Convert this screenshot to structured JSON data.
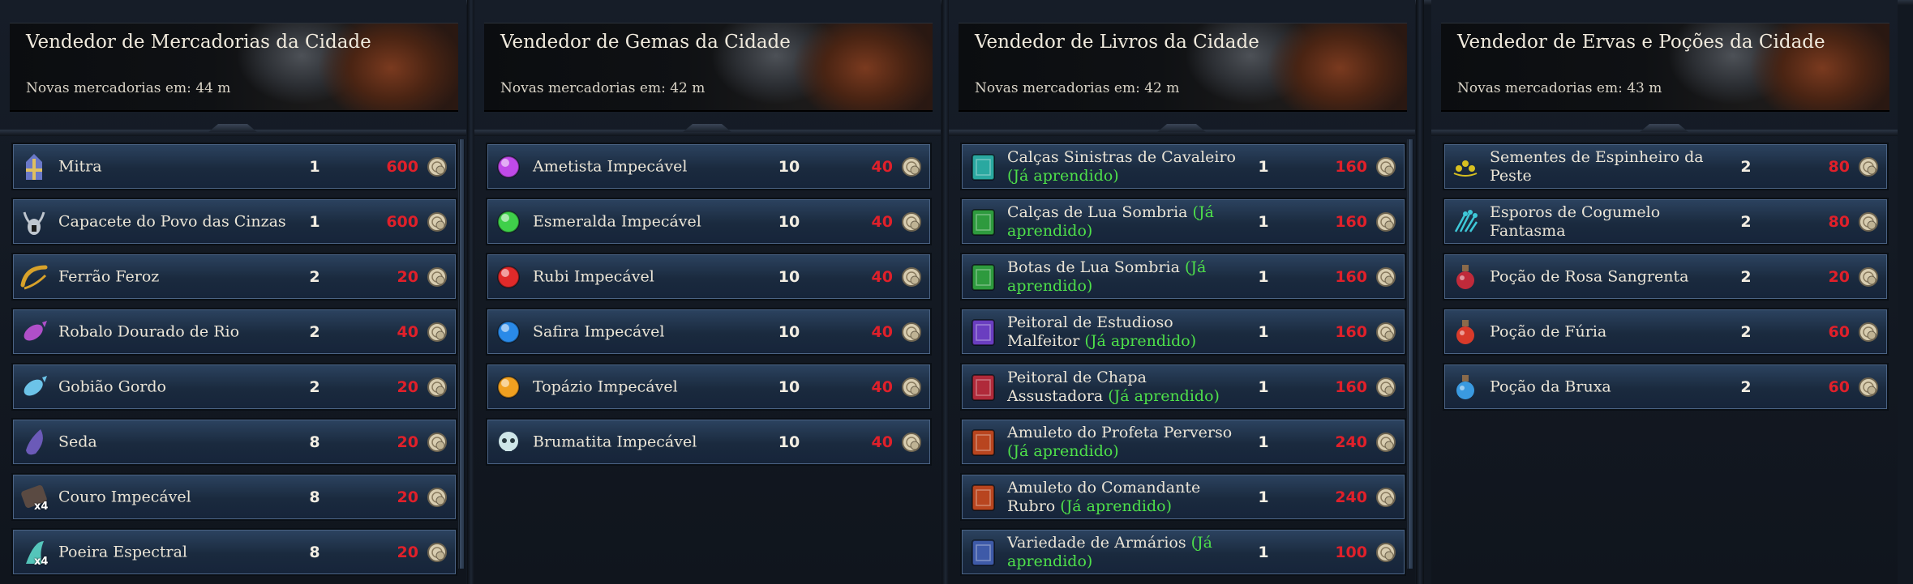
{
  "colors": {
    "price_red": "#e0202a",
    "learned_green": "#4ee04a",
    "row_blue": "#2c4360",
    "background": "#121821"
  },
  "vendors": [
    {
      "title": "Vendedor de Mercadorias da Cidade",
      "subtitle": "Novas mercadorias em: 44 m",
      "scrollbar": true,
      "items": [
        {
          "name": "Mitra",
          "learned": "",
          "qty": "1",
          "price": "600",
          "icon": "miter-icon",
          "icon_color": "#6a78c8"
        },
        {
          "name": "Capacete do Povo das Cinzas",
          "learned": "",
          "qty": "1",
          "price": "600",
          "icon": "horned-helmet-icon",
          "icon_color": "#bfc6cf"
        },
        {
          "name": "Ferrão Feroz",
          "learned": "",
          "qty": "2",
          "price": "20",
          "icon": "stinger-icon",
          "icon_color": "#d8a22a"
        },
        {
          "name": "Robalo Dourado de Rio",
          "learned": "",
          "qty": "2",
          "price": "40",
          "icon": "fish-icon",
          "icon_color": "#b04fc9"
        },
        {
          "name": "Gobião Gordo",
          "learned": "",
          "qty": "2",
          "price": "20",
          "icon": "fish-icon",
          "icon_color": "#6cc3e8"
        },
        {
          "name": "Seda",
          "learned": "",
          "qty": "8",
          "price": "20",
          "icon": "silk-icon",
          "icon_color": "#6b5ab8"
        },
        {
          "name": "Couro Impecável",
          "learned": "",
          "qty": "8",
          "price": "20",
          "icon": "leather-icon",
          "icon_color": "#5a4a42",
          "badge": "x4"
        },
        {
          "name": "Poeira Espectral",
          "learned": "",
          "qty": "8",
          "price": "20",
          "icon": "spectral-dust-icon",
          "icon_color": "#5fe0d0",
          "badge": "x4"
        }
      ]
    },
    {
      "title": "Vendedor de Gemas da Cidade",
      "subtitle": "Novas mercadorias em: 42 m",
      "scrollbar": false,
      "items": [
        {
          "name": "Ametista Impecável",
          "learned": "",
          "qty": "10",
          "price": "40",
          "icon": "amethyst-icon",
          "icon_color": "#c04ae8"
        },
        {
          "name": "Esmeralda Impecável",
          "learned": "",
          "qty": "10",
          "price": "40",
          "icon": "emerald-icon",
          "icon_color": "#3fd04a"
        },
        {
          "name": "Rubi Impecável",
          "learned": "",
          "qty": "10",
          "price": "40",
          "icon": "ruby-icon",
          "icon_color": "#e02a2a"
        },
        {
          "name": "Safira Impecável",
          "learned": "",
          "qty": "10",
          "price": "40",
          "icon": "sapphire-icon",
          "icon_color": "#2a8ae8"
        },
        {
          "name": "Topázio Impecável",
          "learned": "",
          "qty": "10",
          "price": "40",
          "icon": "topaz-icon",
          "icon_color": "#f0a020"
        },
        {
          "name": "Brumatita Impecável",
          "learned": "",
          "qty": "10",
          "price": "40",
          "icon": "skull-gem-icon",
          "icon_color": "#cfe6e8"
        }
      ]
    },
    {
      "title": "Vendedor de Livros da Cidade",
      "subtitle": "Novas mercadorias em: 42 m",
      "scrollbar": true,
      "items": [
        {
          "name": "Calças Sinistras de Cavaleiro",
          "learned": "(Já aprendido)",
          "qty": "1",
          "price": "160",
          "icon": "tome-icon",
          "icon_color": "#2aa8a0"
        },
        {
          "name": "Calças de Lua Sombria",
          "learned": "(Já aprendido)",
          "qty": "1",
          "price": "160",
          "icon": "tome-icon",
          "icon_color": "#2e9a3e"
        },
        {
          "name": "Botas de Lua Sombria",
          "learned": "(Já aprendido)",
          "qty": "1",
          "price": "160",
          "icon": "tome-icon",
          "icon_color": "#2e9a3e"
        },
        {
          "name": "Peitoral de Estudioso Malfeitor",
          "learned": "(Já aprendido)",
          "qty": "1",
          "price": "160",
          "icon": "tome-icon",
          "icon_color": "#6a3ec0"
        },
        {
          "name": "Peitoral de Chapa Assustadora",
          "learned": "(Já aprendido)",
          "qty": "1",
          "price": "160",
          "icon": "tome-icon",
          "icon_color": "#b02a3a"
        },
        {
          "name": "Amuleto do Profeta Perverso",
          "learned": "(Já aprendido)",
          "qty": "1",
          "price": "240",
          "icon": "tome-icon",
          "icon_color": "#b8451f"
        },
        {
          "name": "Amuleto do Comandante Rubro",
          "learned": "(Já aprendido)",
          "qty": "1",
          "price": "240",
          "icon": "tome-icon",
          "icon_color": "#b8451f"
        },
        {
          "name": "Variedade de Armários",
          "learned": "(Já aprendido)",
          "qty": "1",
          "price": "100",
          "icon": "tome-icon",
          "icon_color": "#3e5aa8"
        }
      ]
    },
    {
      "title": "Vendedor de Ervas e Poções da Cidade",
      "subtitle": "Novas mercadorias em: 43 m",
      "scrollbar": false,
      "items": [
        {
          "name": "Sementes de Espinheiro da Peste",
          "learned": "",
          "qty": "2",
          "price": "80",
          "icon": "seeds-icon",
          "icon_color": "#d8c020"
        },
        {
          "name": "Esporos de Cogumelo Fantasma",
          "learned": "",
          "qty": "2",
          "price": "80",
          "icon": "spores-icon",
          "icon_color": "#3ec8d8"
        },
        {
          "name": "Poção de Rosa Sangrenta",
          "learned": "",
          "qty": "2",
          "price": "20",
          "icon": "potion-icon",
          "icon_color": "#c02a3a"
        },
        {
          "name": "Poção de Fúria",
          "learned": "",
          "qty": "2",
          "price": "60",
          "icon": "potion-icon",
          "icon_color": "#d83a2a"
        },
        {
          "name": "Poção da Bruxa",
          "learned": "",
          "qty": "2",
          "price": "60",
          "icon": "potion-icon",
          "icon_color": "#3a9ae0"
        }
      ]
    }
  ]
}
